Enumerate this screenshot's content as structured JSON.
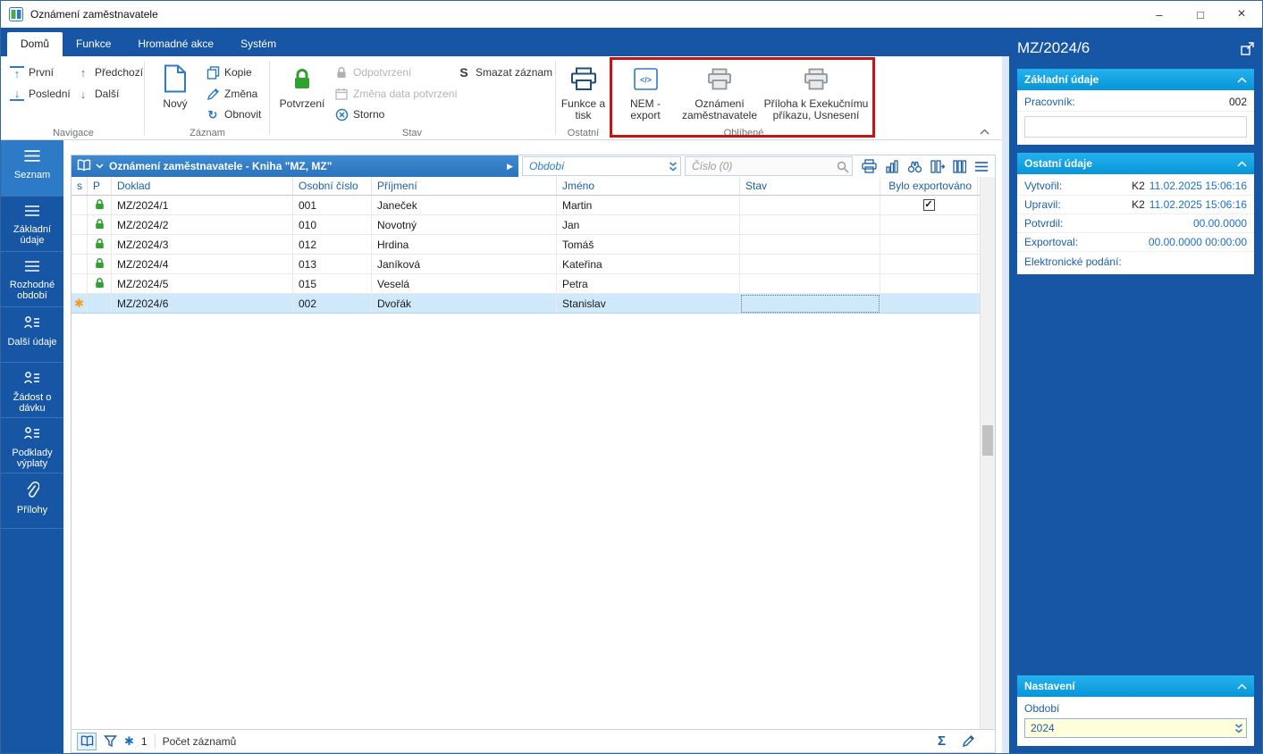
{
  "window": {
    "title": "Oznámení zaměstnavatele"
  },
  "icons": {
    "minimize": "–",
    "maximize": "□",
    "close": "×",
    "arrow_up": "↑",
    "arrow_down": "↓",
    "refresh": "↻",
    "smazat_s": "S",
    "star": "✱",
    "check": "✓",
    "sigma": "Σ",
    "play": "▶",
    "nem_code": "</>"
  },
  "ribbon": {
    "tabs": [
      {
        "label": "Domů"
      },
      {
        "label": "Funkce"
      },
      {
        "label": "Hromadné akce"
      },
      {
        "label": "Systém"
      }
    ],
    "navigace": {
      "group_label": "Navigace",
      "prvni": "První",
      "posledni": "Poslední",
      "predchozi": "Předchozí",
      "dalsi": "Další"
    },
    "zaznam": {
      "group_label": "Záznam",
      "novy": "Nový",
      "kopie": "Kopie",
      "zmena": "Změna",
      "obnovit": "Obnovit"
    },
    "stav": {
      "group_label": "Stav",
      "potvrzeni": "Potvrzení",
      "odpotvrzeni": "Odpotvrzení",
      "zmena_data": "Změna data potvrzení",
      "storno": "Storno",
      "smazat": "Smazat záznam"
    },
    "ostatni": {
      "group_label": "Ostatní",
      "funkce_tisk": "Funkce a tisk"
    },
    "oblibene": {
      "group_label": "Oblíbené",
      "nem_export": "NEM - export",
      "oznameni": "Oznámení zaměstnavatele",
      "priloha": "Příloha k Exekučnímu příkazu, Usnesení"
    }
  },
  "sidebar": {
    "items": [
      {
        "label": "Seznam"
      },
      {
        "label": "Základní údaje"
      },
      {
        "label": "Rozhodné období"
      },
      {
        "label": "Další údaje"
      },
      {
        "label": "Žádost o dávku"
      },
      {
        "label": "Podklady výplaty"
      },
      {
        "label": "Přílohy"
      }
    ]
  },
  "main": {
    "book_title": "Oznámení zaměstnavatele - Kniha \"MZ, MZ\"",
    "filter_obdobi": "Období",
    "filter_cislo": "Číslo (0)",
    "table": {
      "headers": {
        "s": "s",
        "p": "P",
        "doklad": "Doklad",
        "osobni": "Osobní číslo",
        "prijmeni": "Příjmení",
        "jmeno": "Jméno",
        "stav": "Stav",
        "export": "Bylo exportováno"
      },
      "rows": [
        {
          "doklad": "MZ/2024/1",
          "osobni": "001",
          "prijmeni": "Janeček",
          "jmeno": "Martin",
          "stav": "",
          "locked": true,
          "exported": true
        },
        {
          "doklad": "MZ/2024/2",
          "osobni": "010",
          "prijmeni": "Novotný",
          "jmeno": "Jan",
          "stav": "",
          "locked": true
        },
        {
          "doklad": "MZ/2024/3",
          "osobni": "012",
          "prijmeni": "Hrdina",
          "jmeno": "Tomáš",
          "stav": "",
          "locked": true
        },
        {
          "doklad": "MZ/2024/4",
          "osobni": "013",
          "prijmeni": "Janíková",
          "jmeno": "Kateřina",
          "stav": "",
          "locked": true
        },
        {
          "doklad": "MZ/2024/5",
          "osobni": "015",
          "prijmeni": "Veselá",
          "jmeno": "Petra",
          "stav": "",
          "locked": true
        },
        {
          "doklad": "MZ/2024/6",
          "osobni": "002",
          "prijmeni": "Dvořák",
          "jmeno": "Stanislav",
          "stav": "",
          "isNew": true
        }
      ]
    },
    "statusbar": {
      "badge": "1",
      "label": "Počet záznamů"
    }
  },
  "panel": {
    "title": "MZ/2024/6",
    "zakladni": {
      "header": "Základní údaje",
      "pracovnik_label": "Pracovník:",
      "pracovnik_value": "002"
    },
    "ostatni": {
      "header": "Ostatní údaje",
      "rows": [
        {
          "label": "Vytvořil:",
          "who": "K2",
          "when": "11.02.2025 15:06:16"
        },
        {
          "label": "Upravil:",
          "who": "K2",
          "when": "11.02.2025 15:06:16"
        },
        {
          "label": "Potvrdil:",
          "who": "",
          "when": "00.00.0000"
        },
        {
          "label": "Exportoval:",
          "who": "",
          "when": "00.00.0000 00:00:00"
        },
        {
          "label": "Elektronické podání:",
          "who": "",
          "when": ""
        }
      ]
    },
    "nastaveni": {
      "header": "Nastavení",
      "obdobi_label": "Období",
      "obdobi_value": "2024"
    }
  }
}
